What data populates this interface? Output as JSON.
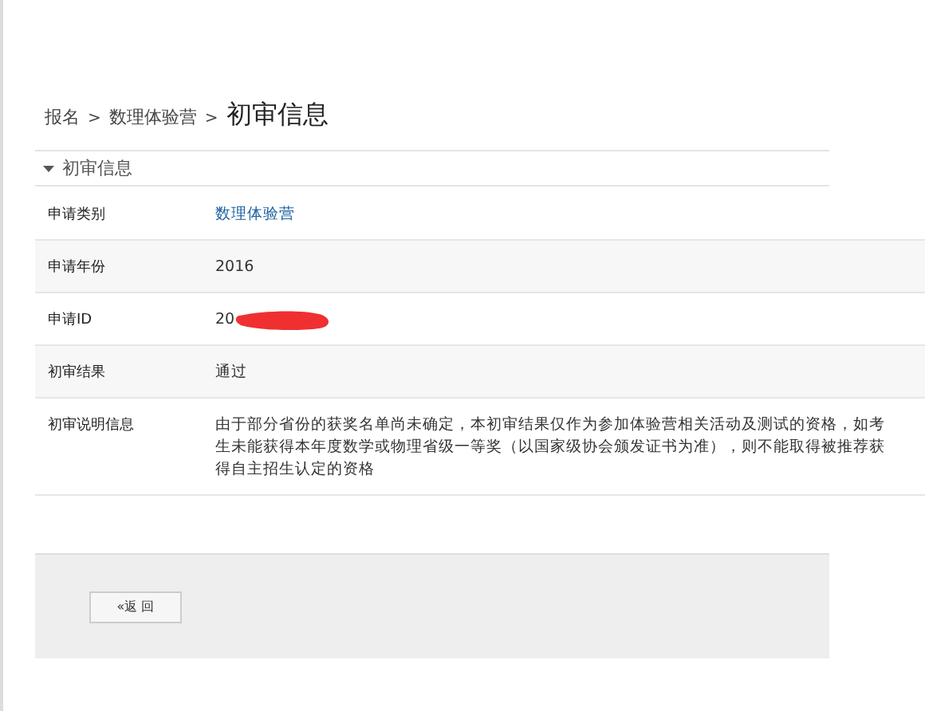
{
  "breadcrumb": [
    {
      "label": "报名",
      "current": false
    },
    {
      "label": "数理体验营",
      "current": false
    },
    {
      "label": "初审信息",
      "current": true
    }
  ],
  "breadcrumb_separator": ">",
  "section": {
    "title": "初审信息",
    "expanded": true
  },
  "rows": [
    {
      "label": "申请类别",
      "value": "数理体验营",
      "kind": "link"
    },
    {
      "label": "申请年份",
      "value": "2016",
      "kind": "text"
    },
    {
      "label": "申请ID",
      "value": "20",
      "kind": "redacted"
    },
    {
      "label": "初审结果",
      "value": "通过",
      "kind": "text"
    },
    {
      "label": "初审说明信息",
      "value": "由于部分省份的获奖名单尚未确定，本初审结果仅作为参加体验营相关活动及测试的资格，如考生未能获得本年度数学或物理省级一等奖（以国家级协会颁发证书为准），则不能取得被推荐获得自主招生认定的资格",
      "kind": "text"
    }
  ],
  "back_button": "«返 回"
}
